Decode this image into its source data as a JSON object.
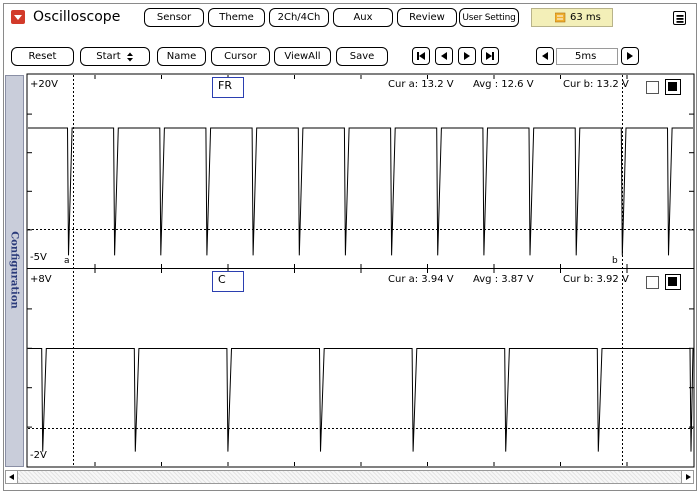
{
  "app": {
    "title": "Oscilloscope",
    "menu_icon": "dropdown-red-icon"
  },
  "top_buttons": [
    "Sensor",
    "Theme",
    "2Ch/4Ch",
    "Aux",
    "Review",
    "User Setting"
  ],
  "status": {
    "icon": "timer-icon",
    "time": "63 ms"
  },
  "toolbar": {
    "reset": "Reset",
    "start": "Start",
    "name": "Name",
    "cursor": "Cursor",
    "viewall": "ViewAll",
    "save": "Save",
    "timebase": "5ms"
  },
  "side_tab": "Configuration",
  "channels": [
    {
      "id": "FR",
      "ymax": "+20V",
      "ymin": "-5V",
      "cur_a": "Cur a: 13.2 V",
      "avg": "Avg  : 12.6 V",
      "cur_b": "Cur b: 13.2 V",
      "cursor_a": "a",
      "cursor_b": "b",
      "waveform": {
        "high": 13.2,
        "low": -4.5,
        "period_ms": 1.52,
        "pulse_ms": 0.12
      }
    },
    {
      "id": "C",
      "ymax": "+8V",
      "ymin": "-2V",
      "cur_a": "Cur a: 3.94 V",
      "avg": "Avg  : 3.87 V",
      "cur_b": "Cur b: 3.92 V",
      "waveform": {
        "high": 3.94,
        "low": -1.6,
        "period_ms": 3.05,
        "pulse_ms": 0.12
      }
    }
  ],
  "colors": {
    "accent_red": "#d23a2a",
    "channel_box": "#2b3fb0",
    "side_tab_bg": "#c9cdda",
    "status_bg": "#f3efb8"
  }
}
